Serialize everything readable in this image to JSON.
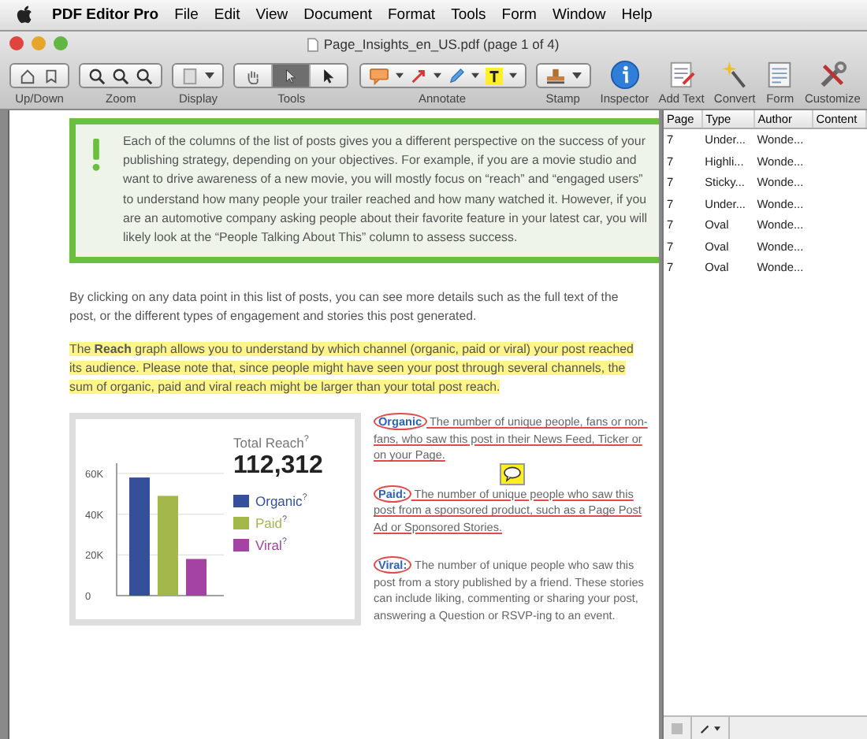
{
  "menubar": {
    "app": "PDF Editor Pro",
    "menus": [
      "File",
      "Edit",
      "View",
      "Document",
      "Format",
      "Tools",
      "Form",
      "Window",
      "Help"
    ]
  },
  "window": {
    "title": "Page_Insights_en_US.pdf (page 1 of 4)"
  },
  "toolbar": [
    {
      "kind": "updown",
      "label": "Up/Down"
    },
    {
      "kind": "zoom",
      "label": "Zoom"
    },
    {
      "kind": "display",
      "label": "Display"
    },
    {
      "kind": "tools",
      "label": "Tools",
      "segments": [
        {
          "selected": false
        },
        {
          "selected": true
        },
        {
          "selected": false
        }
      ]
    },
    {
      "kind": "annotate",
      "label": "Annotate"
    },
    {
      "kind": "stamp",
      "label": "Stamp"
    },
    {
      "kind": "inspector",
      "label": "Inspector"
    },
    {
      "kind": "addtext",
      "label": "Add Text"
    },
    {
      "kind": "convert",
      "label": "Convert"
    },
    {
      "kind": "form",
      "label": "Form"
    },
    {
      "kind": "customize",
      "label": "Customize"
    }
  ],
  "document": {
    "callout": "Each of the columns of the list of posts gives you a different perspective on the success of your publishing strategy, depending on your objectives. For example, if you are a movie studio and want to drive awareness of a new movie, you will mostly focus on “reach” and “engaged users” to understand how many people your trailer reached and how many watched it. However, if you are an automotive company asking people about their favorite feature in your latest car, you will likely look at the “People Talking About This” column to assess success.",
    "paragraphs": [
      {
        "text": "By clicking on any data point in this list of posts, you can see more details such as the full text of the post, or the different types of engagement and stories this post generated.",
        "highlighted": false
      },
      {
        "text": "The **Reach** graph allows you to understand by which channel (organic, paid or viral) your post reached its audience. Please note that, since people might have seen your post through several channels, the sum of organic, paid and viral reach might be larger than your total post reach.",
        "highlighted": true
      }
    ],
    "chart": {
      "title": "Total Reach",
      "title_mark": "?",
      "total": "112,312",
      "legend_marks": [
        "?",
        "?",
        "?"
      ],
      "chart_data": {
        "type": "bar",
        "grid": true,
        "legend": true,
        "ylim": [
          0,
          65000
        ],
        "yticks": [
          {
            "value": 0,
            "label": "0"
          },
          {
            "value": 20000,
            "label": "20K"
          },
          {
            "value": 40000,
            "label": "40K"
          },
          {
            "value": 60000,
            "label": "60K"
          }
        ],
        "series": [
          {
            "name": "Organic",
            "color": "#34509a",
            "values": [
              58000
            ]
          },
          {
            "name": "Paid",
            "color": "#a3b74a",
            "values": [
              49000
            ]
          },
          {
            "name": "Viral",
            "color": "#a443a4",
            "values": [
              18000
            ]
          }
        ]
      }
    },
    "notes": [
      {
        "term": "Organic",
        "text": "The number of unique people, fans or non-fans, who saw this post in their News Feed, Ticker or on your Page.",
        "underlined": true,
        "sticky": false
      },
      {
        "term": "Paid:",
        "text": "The number of unique people who saw this post from a sponsored product, such as a Page Post Ad or Sponsored Stories.",
        "underlined": true,
        "sticky": true
      },
      {
        "term": "Viral:",
        "text": "The number of unique people who saw this post from a story published by a friend. These stories can include liking, commenting or sharing your post, answering a Question or RSVP-ing to an event.",
        "underlined": false,
        "sticky": false
      }
    ]
  },
  "annotations_panel": {
    "columns": [
      "Page",
      "Type",
      "Author",
      "Content"
    ],
    "rows": [
      [
        "7",
        "Under...",
        "Wonde..."
      ],
      [
        "7",
        "Highli...",
        "Wonde..."
      ],
      [
        "7",
        "Sticky...",
        "Wonde..."
      ],
      [
        "7",
        "Under...",
        "Wonde..."
      ],
      [
        "7",
        "Oval",
        "Wonde..."
      ],
      [
        "7",
        "Oval",
        "Wonde..."
      ],
      [
        "7",
        "Oval",
        "Wonde..."
      ]
    ]
  }
}
